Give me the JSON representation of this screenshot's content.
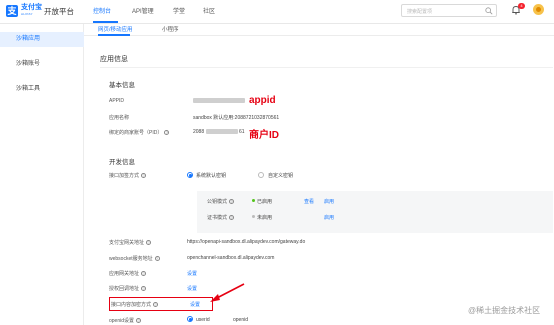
{
  "header": {
    "brand": "支付宝",
    "brand_sub": "ALIPAY",
    "platform": "开放平台",
    "nav": [
      "控制台",
      "API管理",
      "学堂",
      "社区"
    ],
    "search_placeholder": "搜索配置项",
    "badge_count": "4",
    "accent_color": "#1677ff"
  },
  "sidebar": {
    "items": [
      "沙箱应用",
      "沙箱账号",
      "沙箱工具"
    ]
  },
  "tabs": [
    "网页/移动应用",
    "小程序"
  ],
  "app_info": {
    "section_title": "应用信息",
    "group_title": "基本信息",
    "appid_label": "APPID",
    "appid_annotation": "appid",
    "app_name_label": "应用名称",
    "app_name_value": "sandbox 默认应用:2088721032870561",
    "merchant_label": "绑定的商家账号（PID）",
    "merchant_value_prefix": "2088",
    "merchant_value_suffix": "61",
    "merchant_annotation": "商户ID"
  },
  "dev_info": {
    "group_title": "开发信息",
    "sign_label": "接口加签方式",
    "sign_options": [
      "系统默认密钥",
      "自定义密钥"
    ],
    "key_rows": [
      {
        "label": "公钥模式",
        "status": "已启用",
        "actions": [
          "查看",
          "启用"
        ]
      },
      {
        "label": "证书模式",
        "status": "未启用",
        "actions": [
          "",
          "启用"
        ]
      }
    ],
    "gateway_label": "支付宝网关地址",
    "gateway_value": "https://openapi-sandbox.dl.alipaydev.com/gateway.do",
    "websocket_label": "websocket服务地址",
    "websocket_value": "openchannel-sandbox.dl.alipaydev.com",
    "app_gateway_label": "应用网关地址",
    "app_gateway_action": "设置",
    "callback_label": "授权回调地址",
    "callback_action": "设置",
    "encrypt_label": "接口内容加密方式",
    "encrypt_action": "设置",
    "openid_label": "openid设置",
    "openid_options": [
      "userid",
      "openid"
    ]
  },
  "watermark": "@稀土掘金技术社区"
}
